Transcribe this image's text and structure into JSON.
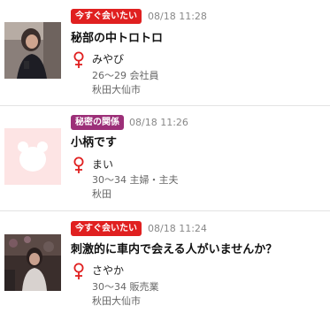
{
  "posts": [
    {
      "tag": "今すぐ会いたい",
      "tag_color": "#e02020",
      "timestamp": "08/18 11:28",
      "title": "秘部の中トロトロ",
      "gender_icon": "female-icon",
      "name": "みやび",
      "age_job": "26～29 会社員",
      "location": "秋田大仙市"
    },
    {
      "tag": "秘密の関係",
      "tag_color": "#9c2f78",
      "timestamp": "08/18 11:26",
      "title": "小柄です",
      "gender_icon": "female-icon",
      "name": "まい",
      "age_job": "30～34 主婦・主夫",
      "location": "秋田"
    },
    {
      "tag": "今すぐ会いたい",
      "tag_color": "#e02020",
      "timestamp": "08/18 11:24",
      "title": "刺激的に車内で会える人がいませんか？",
      "gender_icon": "female-icon",
      "name": "さやか",
      "age_job": "30～34 販売業",
      "location": "秋田大仙市"
    }
  ]
}
